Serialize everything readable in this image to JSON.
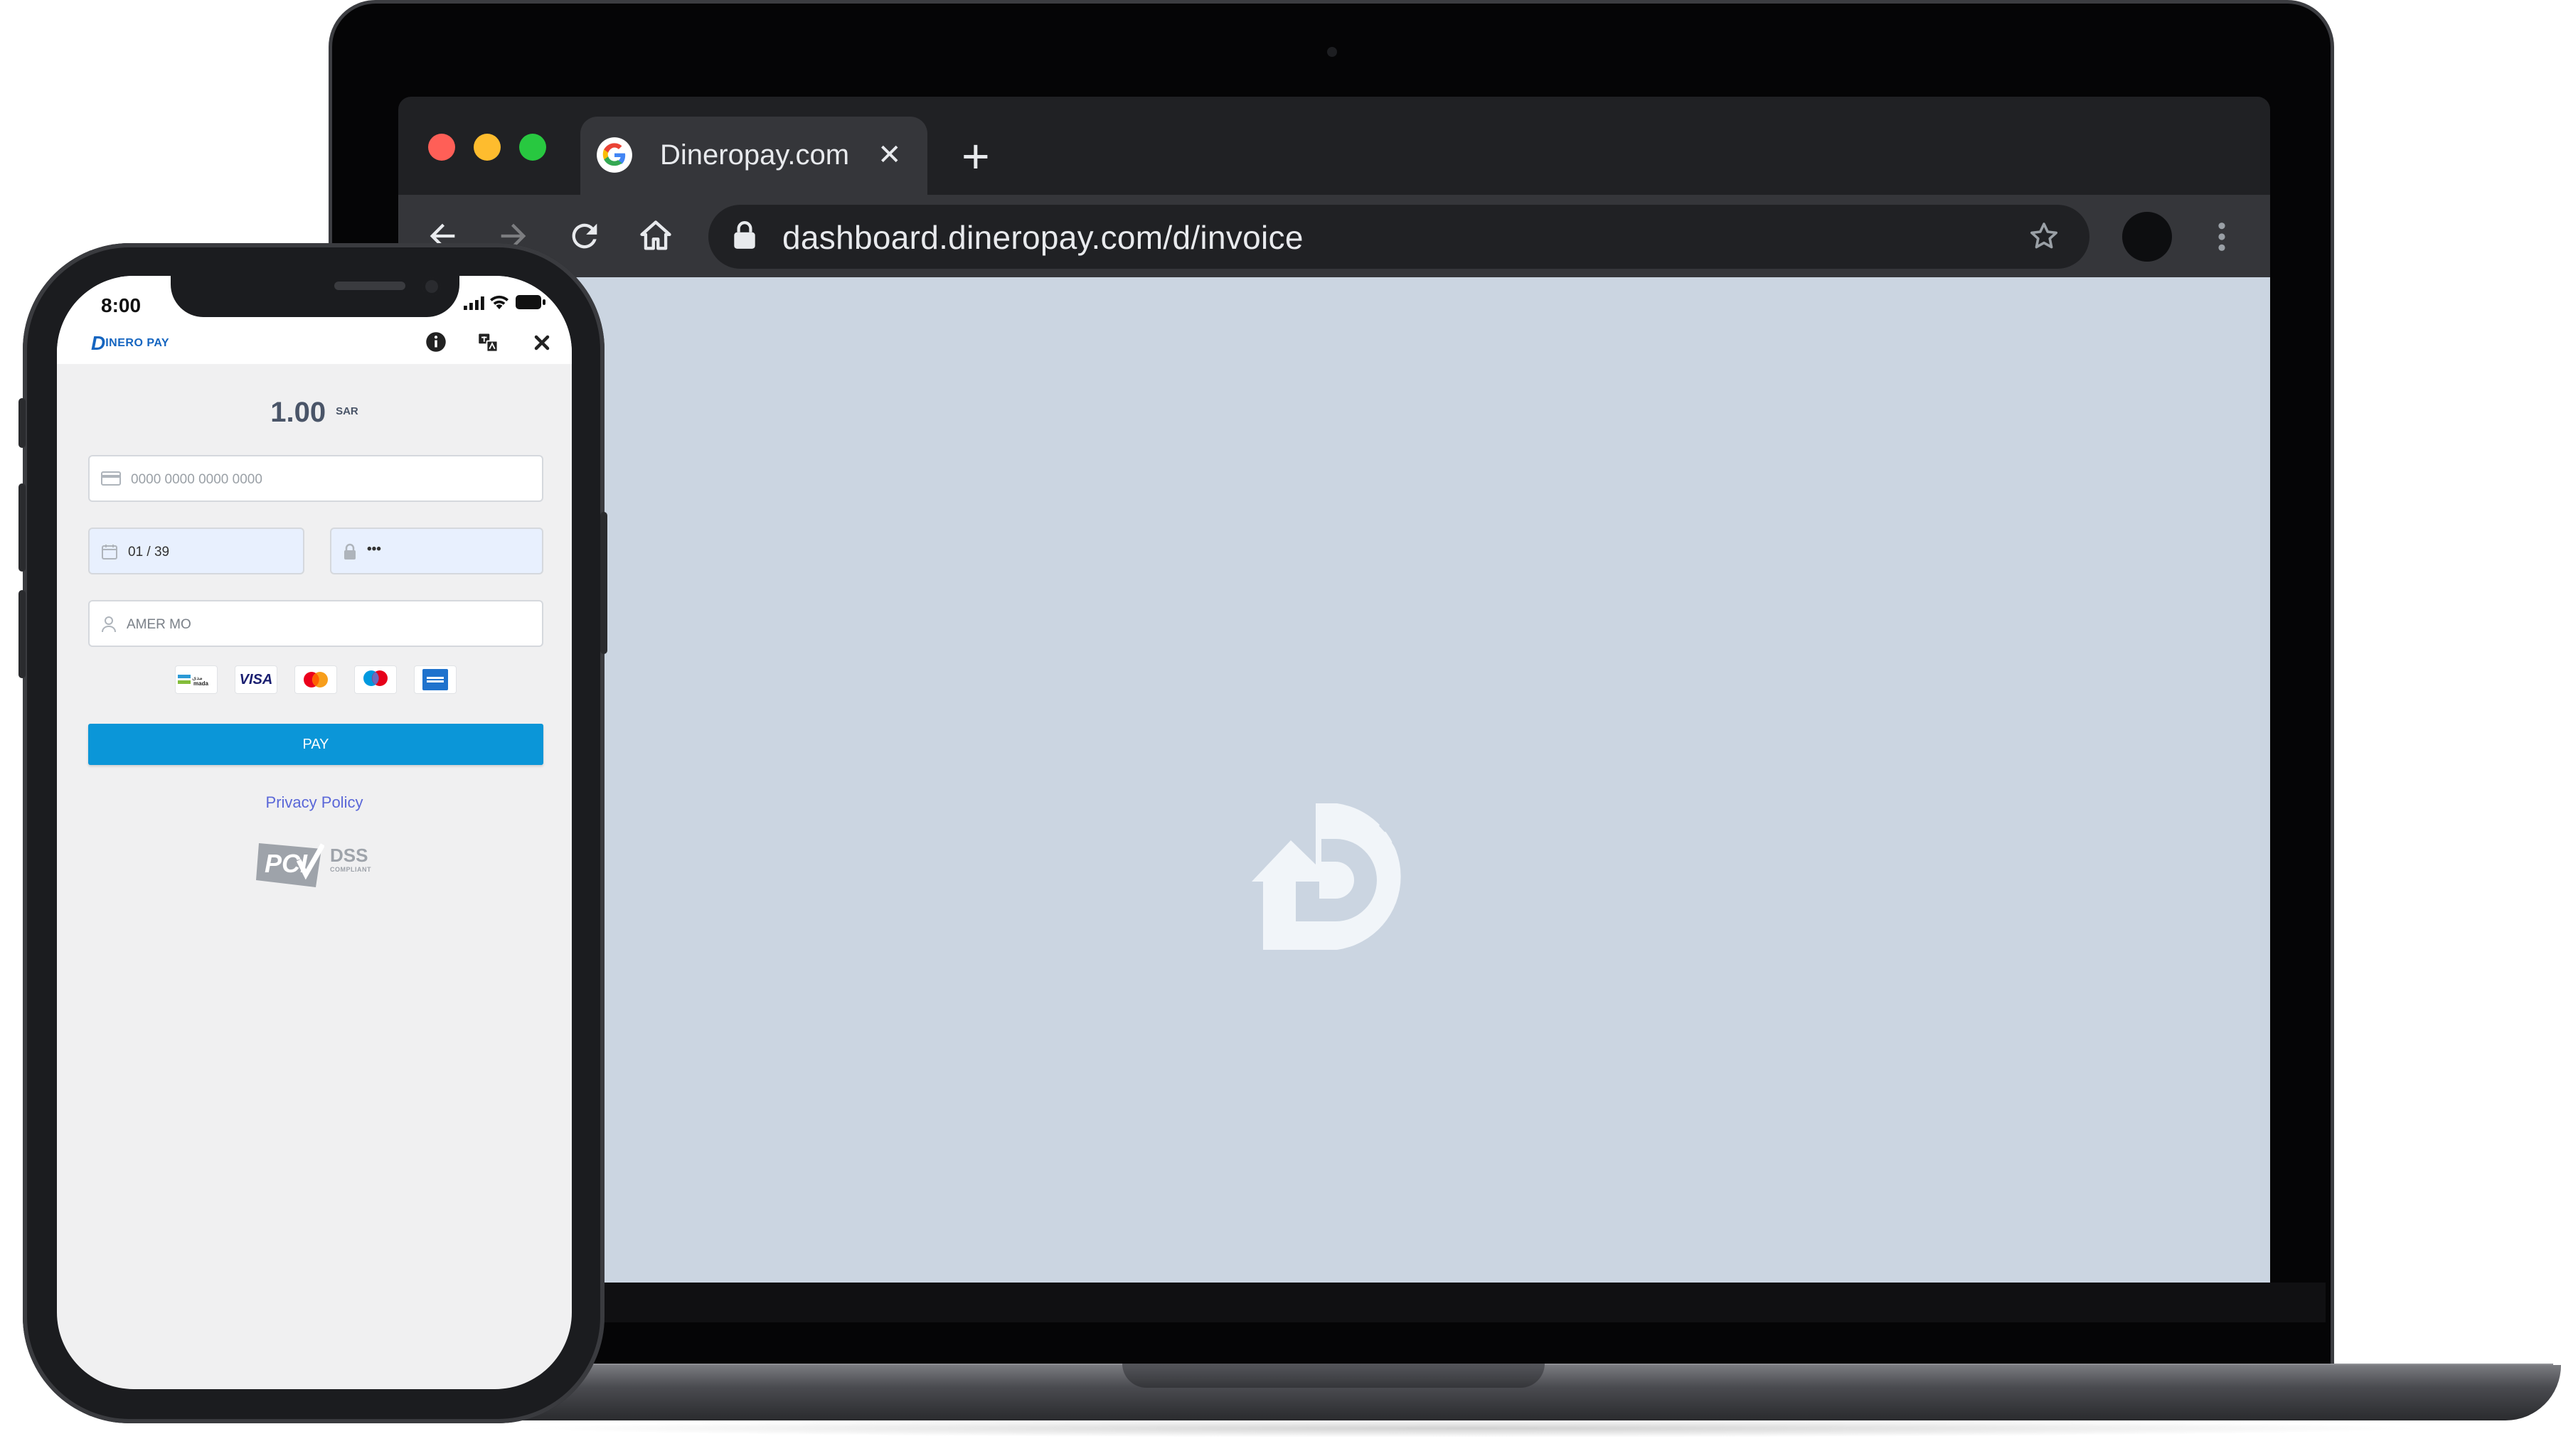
{
  "browser": {
    "tab_title": "Dineropay.com",
    "close_tab_glyph": "✕",
    "new_tab_glyph": "+",
    "url": "dashboard.dineropay.com/d/invoice",
    "icons": [
      "back-arrow-icon",
      "forward-arrow-icon",
      "reload-icon",
      "home-icon",
      "lock-icon",
      "star-icon",
      "profile-avatar",
      "more-menu-icon"
    ],
    "traffic_lights": {
      "close": "#ff5f57",
      "minimize": "#febc2e",
      "maximize": "#28c840"
    }
  },
  "viewport": {
    "background": "#cbd5e1",
    "logo": "dineropay-d-logo"
  },
  "phone": {
    "status_time": "8:00",
    "brand_logo": {
      "letter": "D",
      "text": "INERO PAY"
    },
    "amount": "1.00",
    "currency": "SAR",
    "card_number_placeholder": "0000 0000 0000 0000",
    "expiry_value": "01 / 39",
    "cvv_value": "•••",
    "name_value": "AMER MO",
    "card_logos": [
      "mada",
      "VISA",
      "mastercard",
      "maestro",
      "american-express"
    ],
    "visa_label": "VISA",
    "mada_label": "mada",
    "pay_label": "PAY",
    "privacy_label": "Privacy Policy",
    "pci_label": "PCI",
    "dss_label": "DSS",
    "compliant_label": "COMPLIANT",
    "accent_color": "#0b96d8"
  }
}
